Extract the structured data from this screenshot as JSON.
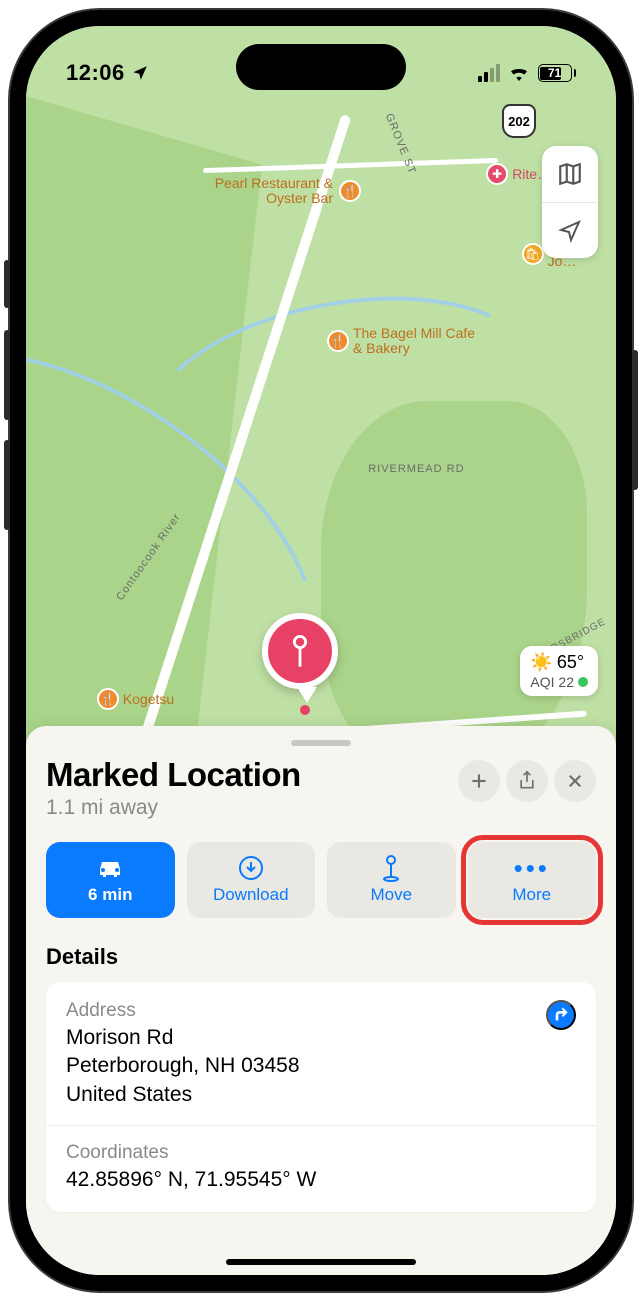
{
  "statusbar": {
    "time": "12:06",
    "battery_pct": "71",
    "battery_fill_pct": 71
  },
  "shield_route": "202",
  "roads": {
    "rivermead": "RIVERMEAD RD",
    "contoocook": "Contoocook River",
    "grove": "GROVE ST",
    "powers": "POWERSBRIDGE"
  },
  "pois": {
    "pearl": "Pearl Restaurant & Oyster Bar",
    "bagel": "The Bagel Mill Cafe & Bakery",
    "kogetsu": "Kogetsu",
    "ocjo": "Oc… Jo…",
    "rite": "Rite…"
  },
  "weather": {
    "temp": "65°",
    "aqi_label": "AQI 22"
  },
  "sheet": {
    "title": "Marked Location",
    "subtitle": "1.1 mi away",
    "actions": {
      "drive_time": "6 min",
      "download": "Download",
      "move": "Move",
      "more": "More"
    },
    "details_heading": "Details",
    "address_label": "Address",
    "address_line1": "Morison Rd",
    "address_line2": "Peterborough, NH  03458",
    "address_line3": "United States",
    "coords_label": "Coordinates",
    "coords_value": "42.85896° N, 71.95545° W"
  }
}
